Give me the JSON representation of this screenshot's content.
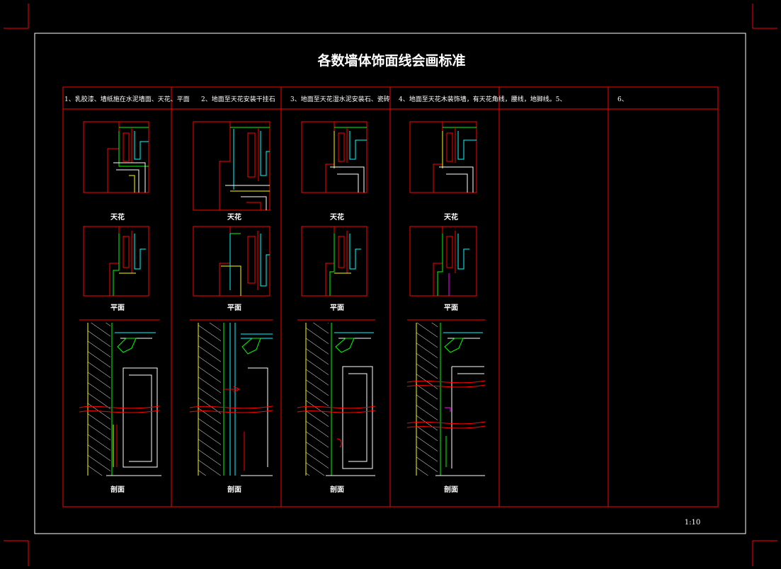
{
  "drawing": {
    "title": "各数墙体饰面线会画标准",
    "scale_label": "1:10",
    "columns": [
      {
        "header": "1、乳胶漆、墙纸施在水泥墙面、天花、平面"
      },
      {
        "header": "2、地面至天花安装干挂石"
      },
      {
        "header": "3、地面至天花湿水泥安装石、瓷砖"
      },
      {
        "header": "4、地面至天花木装饰墙，有天花角线，腰线，地脚线。5、"
      },
      {
        "header": ""
      },
      {
        "header": "6、"
      }
    ],
    "captions": {
      "ceiling": "天花",
      "plan": "平面",
      "section": "剖面"
    },
    "colors": {
      "background": "#000000",
      "frame": "#ffffff",
      "grid": "#ff0000",
      "finish_green": "#00ff00",
      "finish_cyan": "#00ffff",
      "finish_yellow": "#ffff00",
      "accent_magenta": "#ff00ff"
    }
  }
}
